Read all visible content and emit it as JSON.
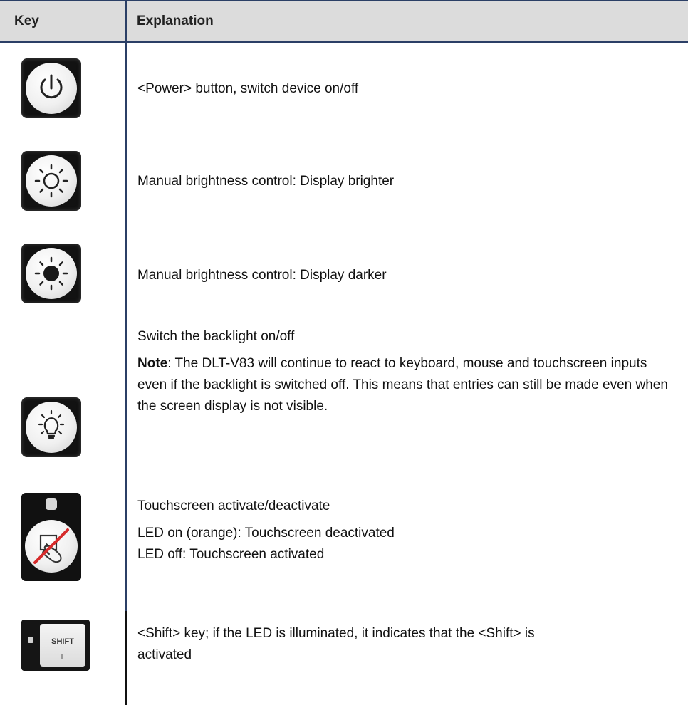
{
  "table": {
    "header": {
      "key": "Key",
      "explanation": "Explanation"
    },
    "rows": [
      {
        "icon": "power-key-icon",
        "lines": [
          "<Power> button, switch device on/off"
        ]
      },
      {
        "icon": "brightness-up-key-icon",
        "lines": [
          "Manual brightness control: Display brighter"
        ]
      },
      {
        "icon": "brightness-down-key-icon",
        "lines": [
          "Manual brightness control: Display darker"
        ]
      },
      {
        "icon": "backlight-key-icon",
        "lines": [
          "Switch the backlight on/off"
        ],
        "note_label": "Note",
        "note_text": ": The DLT-V83 will continue to react to keyboard, mouse and touchscreen inputs even if the backlight is switched off. This means that entries can still be made even when the screen display is not visible."
      },
      {
        "icon": "touchscreen-key-icon",
        "lines": [
          "Touchscreen activate/deactivate",
          "LED on (orange): Touchscreen deactivated",
          "LED off: Touchscreen activated"
        ]
      },
      {
        "icon": "shift-key-icon",
        "key_label": "SHIFT",
        "lines": [
          "<Shift> key; if the LED is illuminated, it indicates that the <Shift> is activated"
        ]
      }
    ]
  },
  "colors": {
    "header_bg": "#dcdcdc",
    "rule": "#2b3f66",
    "slash_red": "#d62b2b"
  }
}
